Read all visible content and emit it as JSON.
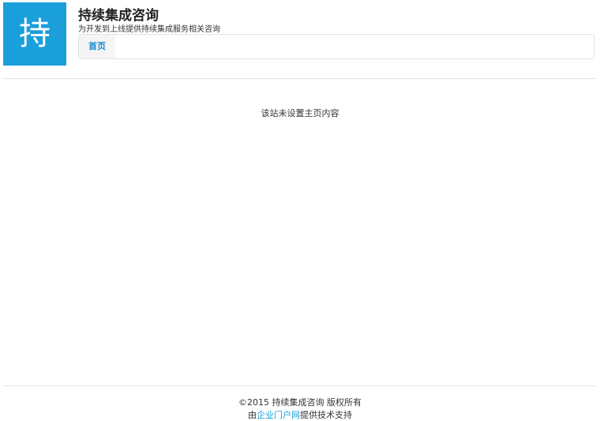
{
  "header": {
    "logo_char": "持",
    "title": "持续集成咨询",
    "tagline": "为开发到上线提供持续集成服务相关咨询"
  },
  "nav": {
    "items": [
      {
        "label": "首页"
      }
    ]
  },
  "main": {
    "message": "该站未设置主页内容"
  },
  "footer": {
    "copyright": "©2015 持续集成咨询 版权所有",
    "support_prefix": "由",
    "support_link": "企业门户网",
    "support_suffix": "提供技术支持"
  },
  "colors": {
    "accent": "#1a9fdb",
    "nav_text": "#1a8ccc",
    "text": "#333333",
    "divider": "#e2e2e2"
  }
}
